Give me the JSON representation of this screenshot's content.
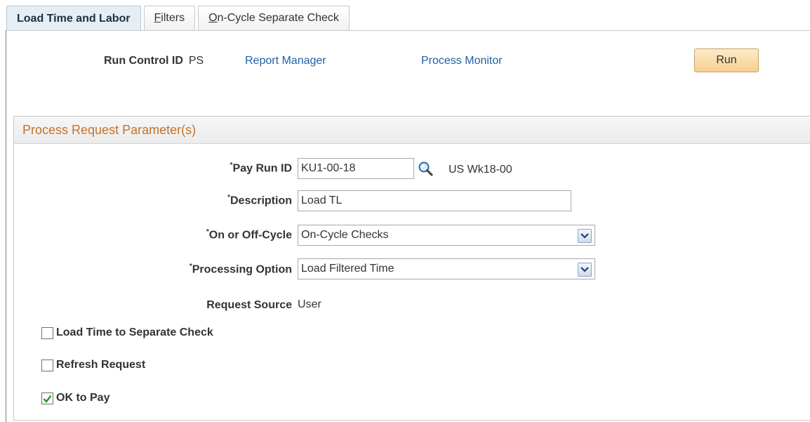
{
  "tabs": [
    {
      "label": "Load Time and Labor",
      "active": true
    },
    {
      "label_accel": "F",
      "label_rest": "ilters"
    },
    {
      "label_accel": "O",
      "label_rest": "n-Cycle Separate Check"
    }
  ],
  "header": {
    "run_control_label": "Run Control ID",
    "run_control_value": "PS",
    "report_manager_link": "Report Manager",
    "process_monitor_link": "Process Monitor",
    "run_button": "Run"
  },
  "group": {
    "title": "Process Request Parameter(s)",
    "pay_run_id": {
      "label": "Pay Run ID",
      "value": "KU1-00-18",
      "description": "US Wk18-00",
      "icon": "search-icon"
    },
    "description": {
      "label": "Description",
      "value": "Load TL"
    },
    "cycle": {
      "label": "On or Off-Cycle",
      "value": "On-Cycle Checks"
    },
    "processing_option": {
      "label": "Processing Option",
      "value": "Load Filtered Time"
    },
    "request_source": {
      "label": "Request Source",
      "value": "User"
    },
    "load_time_separate": {
      "label": "Load Time to Separate Check",
      "checked": false
    },
    "refresh_request": {
      "label": "Refresh Request",
      "checked": false
    },
    "ok_to_pay": {
      "label": "OK to Pay",
      "checked": true
    }
  },
  "colors": {
    "accent_link": "#1f5fa8",
    "group_title": "#c5722b",
    "run_button": "#f7cf8c",
    "check": "#2e8b2e"
  }
}
